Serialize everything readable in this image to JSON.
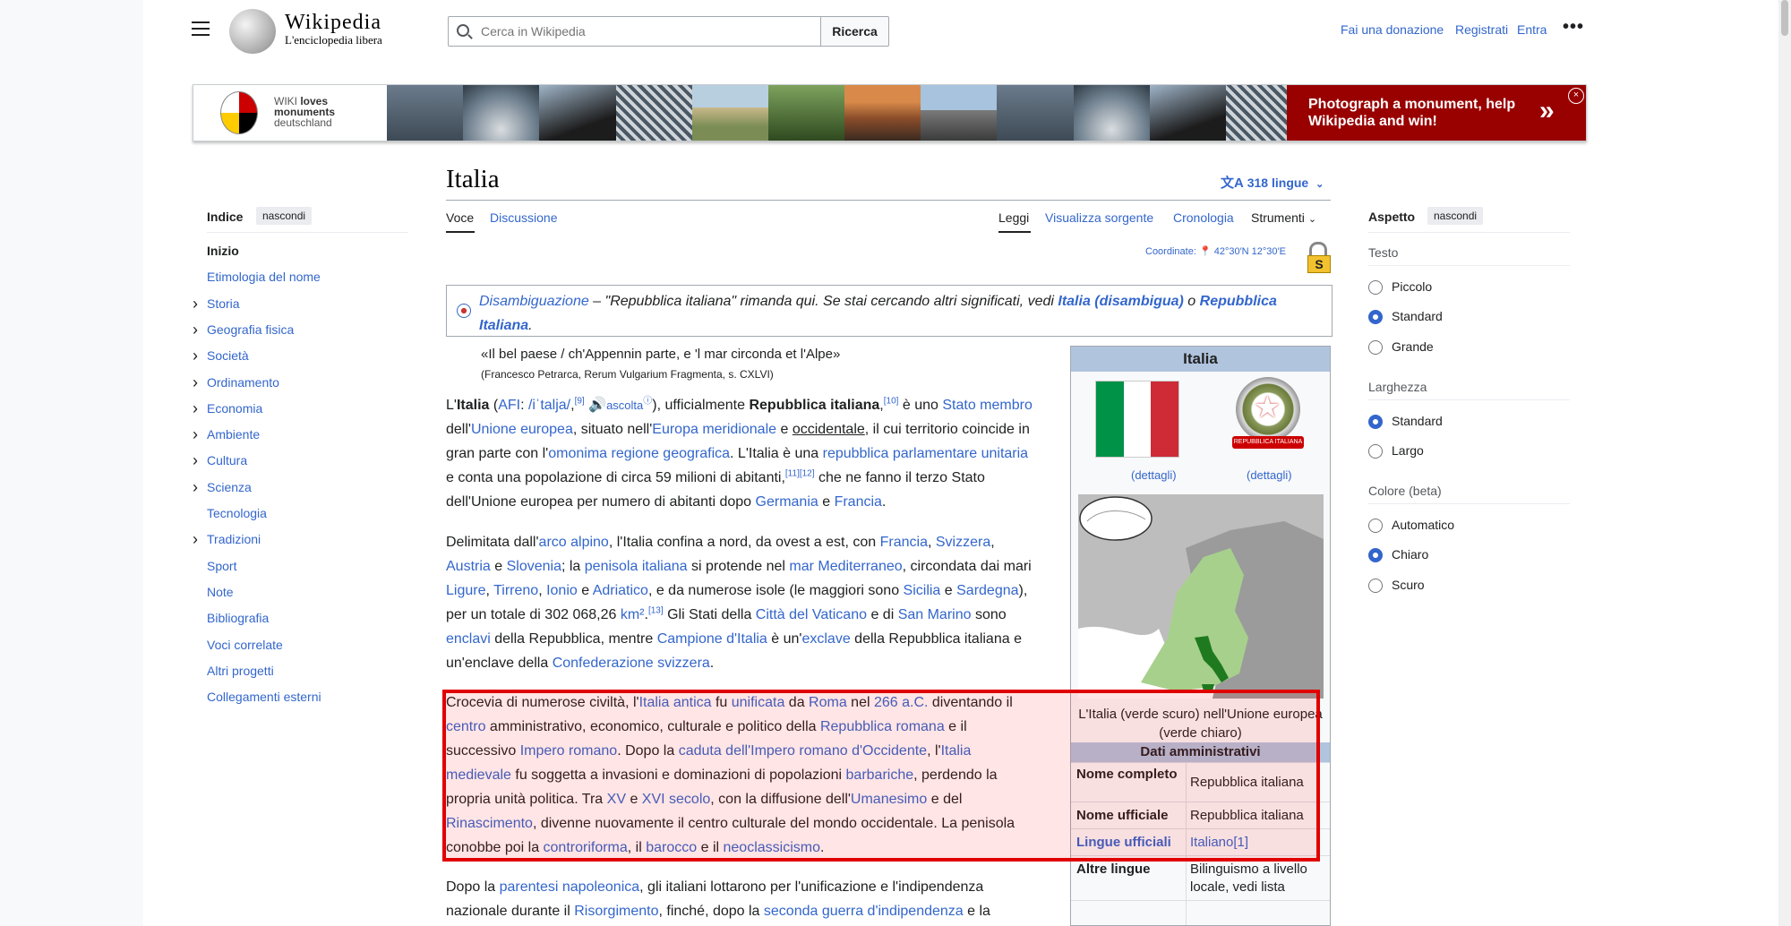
{
  "header": {
    "logo_title": "Wikipedia",
    "logo_tagline": "L'enciclopedia libera",
    "search_placeholder": "Cerca in Wikipedia",
    "search_button": "Ricerca",
    "links": [
      "Fai una donazione",
      "Registrati",
      "Entra"
    ],
    "more": "•••"
  },
  "banner": {
    "logo_line1": "WIKI",
    "logo_line1b": "loves",
    "logo_line2": "monuments",
    "logo_line3": "deutschland",
    "cta": "Photograph a monument, help Wikipedia and win!",
    "arrow": "»",
    "close": "×"
  },
  "toc": {
    "title": "Indice",
    "hide": "nascondi",
    "items": [
      {
        "label": "Inizio",
        "expandable": false
      },
      {
        "label": "Etimologia del nome",
        "expandable": false
      },
      {
        "label": "Storia",
        "expandable": true
      },
      {
        "label": "Geografia fisica",
        "expandable": true
      },
      {
        "label": "Società",
        "expandable": true
      },
      {
        "label": "Ordinamento",
        "expandable": true
      },
      {
        "label": "Economia",
        "expandable": true
      },
      {
        "label": "Ambiente",
        "expandable": true
      },
      {
        "label": "Cultura",
        "expandable": true
      },
      {
        "label": "Scienza",
        "expandable": true
      },
      {
        "label": "Tecnologia",
        "expandable": false
      },
      {
        "label": "Tradizioni",
        "expandable": true
      },
      {
        "label": "Sport",
        "expandable": false
      },
      {
        "label": "Note",
        "expandable": false
      },
      {
        "label": "Bibliografia",
        "expandable": false
      },
      {
        "label": "Voci correlate",
        "expandable": false
      },
      {
        "label": "Altri progetti",
        "expandable": false
      },
      {
        "label": "Collegamenti esterni",
        "expandable": false
      }
    ]
  },
  "article": {
    "title": "Italia",
    "languages": "318 lingue",
    "tabs_left": [
      "Voce",
      "Discussione"
    ],
    "tabs_right": [
      "Leggi",
      "Visualizza sorgente",
      "Cronologia",
      "Strumenti"
    ],
    "coords_label": "Coordinate:",
    "coords_value": "42°30′N 12°30′E",
    "lock_letter": "S",
    "hatnote": {
      "link1": "Disambiguazione",
      "text1": " – \"Repubblica italiana\" rimanda qui. Se stai cercando altri significati, vedi ",
      "link2": "Italia (disambigua)",
      "text2": " o ",
      "link3": "Repubblica Italiana",
      "text3": "."
    },
    "quote": "«Il bel paese / ch'Appennin parte, e 'l mar circonda et l'Alpe»",
    "quote_source": "(Francesco Petrarca, Rerum Vulgarium Fragmenta, s. CXLVI)"
  },
  "infobox": {
    "title": "Italia",
    "dettagli": "(dettagli)",
    "emblem_ribbon": "REPUBBLICA ITALIANA",
    "caption": "L'Italia (verde scuro) nell'Unione europea (verde chiaro)",
    "section": "Dati amministrativi",
    "rows": [
      {
        "k": "Nome completo",
        "v": "Repubblica italiana"
      },
      {
        "k": "Nome ufficiale",
        "v": "Repubblica italiana"
      },
      {
        "k": "Lingue ufficiali",
        "v": "Italiano[1]"
      },
      {
        "k": "Altre lingue",
        "v": "Bilinguismo a livello locale, vedi lista"
      }
    ]
  },
  "appearance": {
    "title": "Aspetto",
    "hide": "nascondi",
    "groups": [
      {
        "label": "Testo",
        "options": [
          "Piccolo",
          "Standard",
          "Grande"
        ],
        "selected": "Standard"
      },
      {
        "label": "Larghezza",
        "options": [
          "Standard",
          "Largo"
        ],
        "selected": "Standard"
      },
      {
        "label": "Colore (beta)",
        "options": [
          "Automatico",
          "Chiaro",
          "Scuro"
        ],
        "selected": "Chiaro"
      }
    ]
  },
  "colors": {
    "link": "#3366cc",
    "highlight_border": "#e00000",
    "infobox_header": "#b0c4de",
    "banner_cta": "#990000",
    "flag": [
      "#009246",
      "#ffffff",
      "#ce2b37"
    ]
  }
}
